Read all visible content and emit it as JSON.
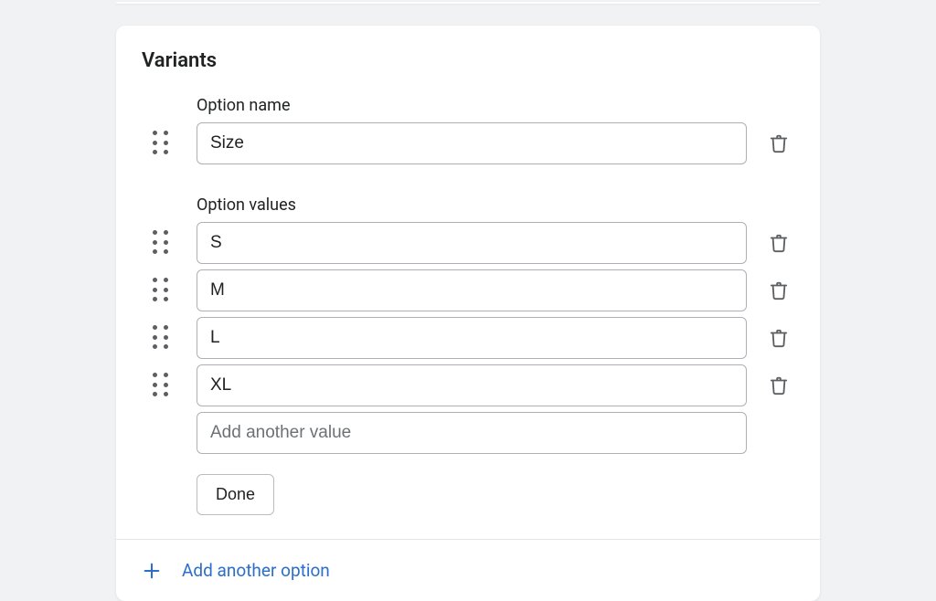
{
  "section": {
    "title": "Variants"
  },
  "option": {
    "name_label": "Option name",
    "name_value": "Size",
    "values_label": "Option values",
    "values": [
      {
        "text": "S"
      },
      {
        "text": "M"
      },
      {
        "text": "L"
      },
      {
        "text": "XL"
      }
    ],
    "add_value_placeholder": "Add another value",
    "done_label": "Done"
  },
  "footer": {
    "add_option_label": "Add another option"
  }
}
